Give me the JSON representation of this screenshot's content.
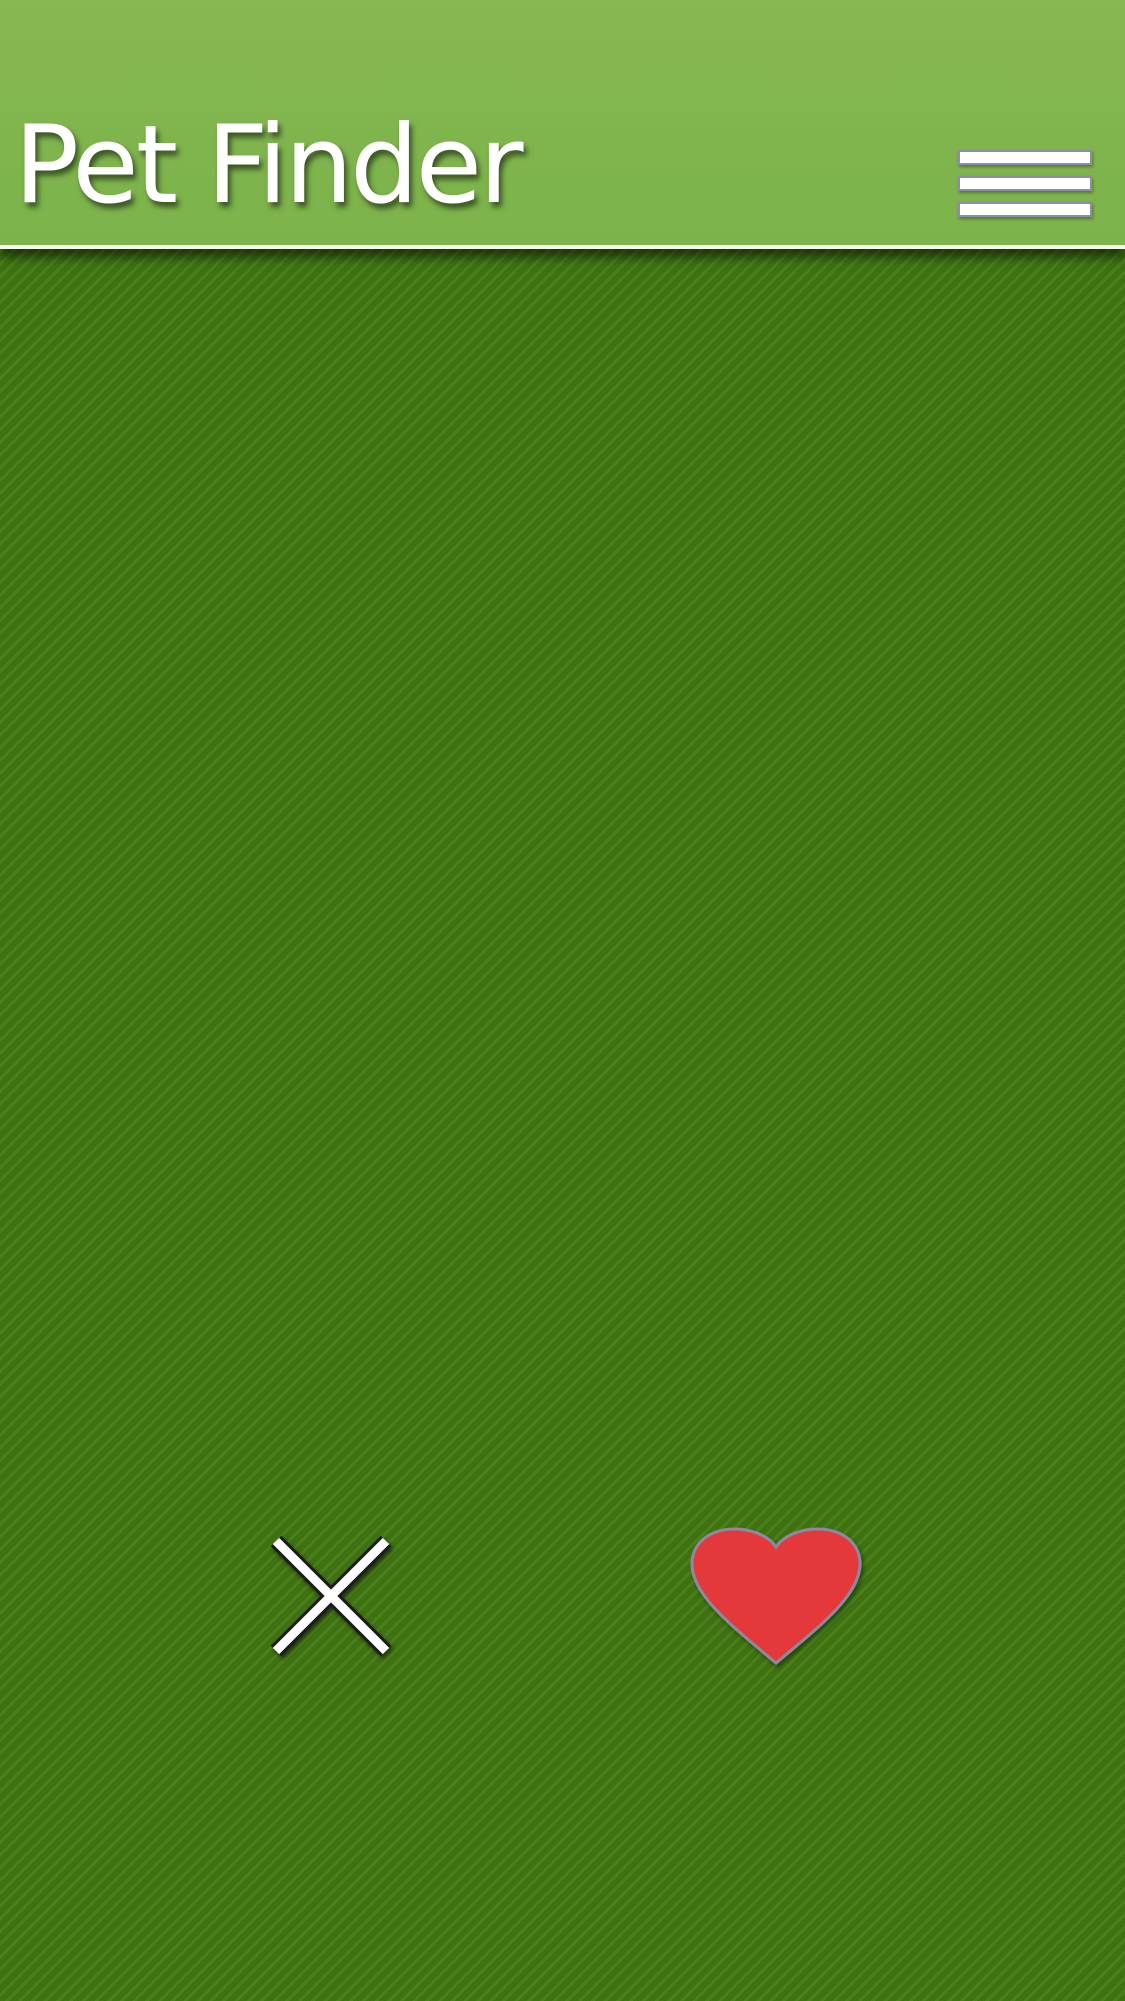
{
  "header": {
    "title": "Pet Finder",
    "menu_icon": "hamburger-menu-icon"
  },
  "actions": {
    "reject_icon": "close-x-icon",
    "like_icon": "heart-icon"
  },
  "colors": {
    "header_green": "#7cb34a",
    "background_green": "#3e7110",
    "heart_red": "#e5383b"
  }
}
